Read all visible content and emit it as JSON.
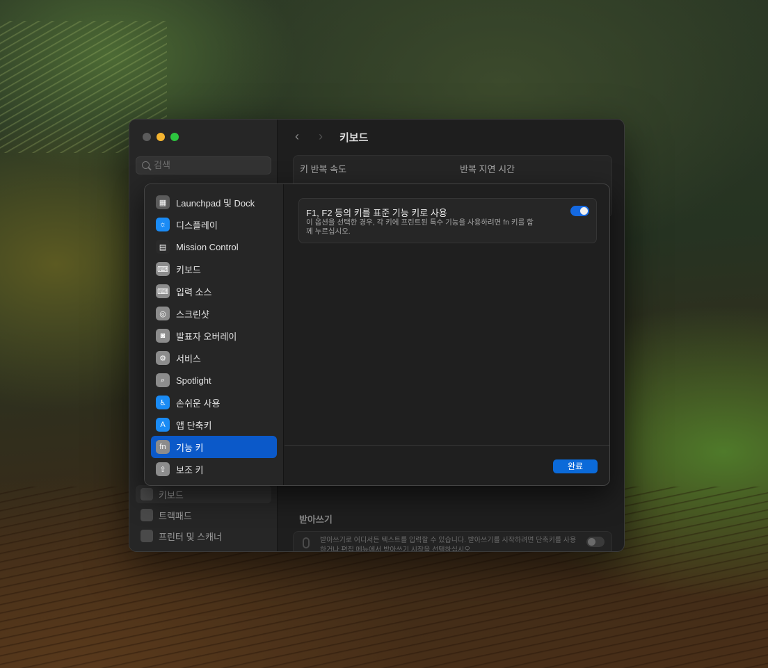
{
  "window": {
    "title": "키보드",
    "search_placeholder": "검색",
    "repeat_rate_label": "키 반복 속도",
    "delay_label": "반복 지연 시간",
    "sidebar_bottom": [
      {
        "label": "키보드"
      },
      {
        "label": "트랙패드"
      },
      {
        "label": "프린터 및 스캐너"
      }
    ],
    "dictation": {
      "title": "받아쓰기",
      "description": "받아쓰기로 어디서든 텍스트를 입력할 수 있습니다. 받아쓰기를 시작하려면 단축키를 사용하거나 편집 메뉴에서 받아쓰기 시작을 선택하십시오."
    }
  },
  "sheet": {
    "items": [
      {
        "label": "Launchpad 및 Dock",
        "icon": "launchpad-icon",
        "color": "#5b5b5b"
      },
      {
        "label": "디스플레이",
        "icon": "display-icon",
        "color": "#1a8bf5"
      },
      {
        "label": "Mission Control",
        "icon": "mission-control-icon",
        "color": "#2a2a2a"
      },
      {
        "label": "키보드",
        "icon": "keyboard-icon",
        "color": "#8c8c8c"
      },
      {
        "label": "입력 소스",
        "icon": "input-source-icon",
        "color": "#8c8c8c"
      },
      {
        "label": "스크린샷",
        "icon": "screenshot-icon",
        "color": "#8c8c8c"
      },
      {
        "label": "발표자 오버레이",
        "icon": "presenter-overlay-icon",
        "color": "#8c8c8c"
      },
      {
        "label": "서비스",
        "icon": "services-icon",
        "color": "#8c8c8c"
      },
      {
        "label": "Spotlight",
        "icon": "spotlight-icon",
        "color": "#8c8c8c"
      },
      {
        "label": "손쉬운 사용",
        "icon": "accessibility-icon",
        "color": "#1a8bf5"
      },
      {
        "label": "앱 단축키",
        "icon": "app-shortcuts-icon",
        "color": "#1a8bf5"
      },
      {
        "label": "기능 키",
        "icon": "function-key-icon",
        "color": "#8c8c8c",
        "glyph": "fn"
      },
      {
        "label": "보조 키",
        "icon": "modifier-key-icon",
        "color": "#8c8c8c"
      }
    ],
    "option": {
      "title": "F1, F2 등의 키를 표준 기능 키로 사용",
      "description": "이 옵션을 선택한 경우, 각 키에 프린트된 특수 기능을 사용하려면 fn 키를 함께 누르십시오.",
      "enabled": true
    },
    "done_label": "완료"
  },
  "colors": {
    "accent": "#0b59c9",
    "toggle_on": "#1469e2",
    "button": "#0b6ad9"
  }
}
